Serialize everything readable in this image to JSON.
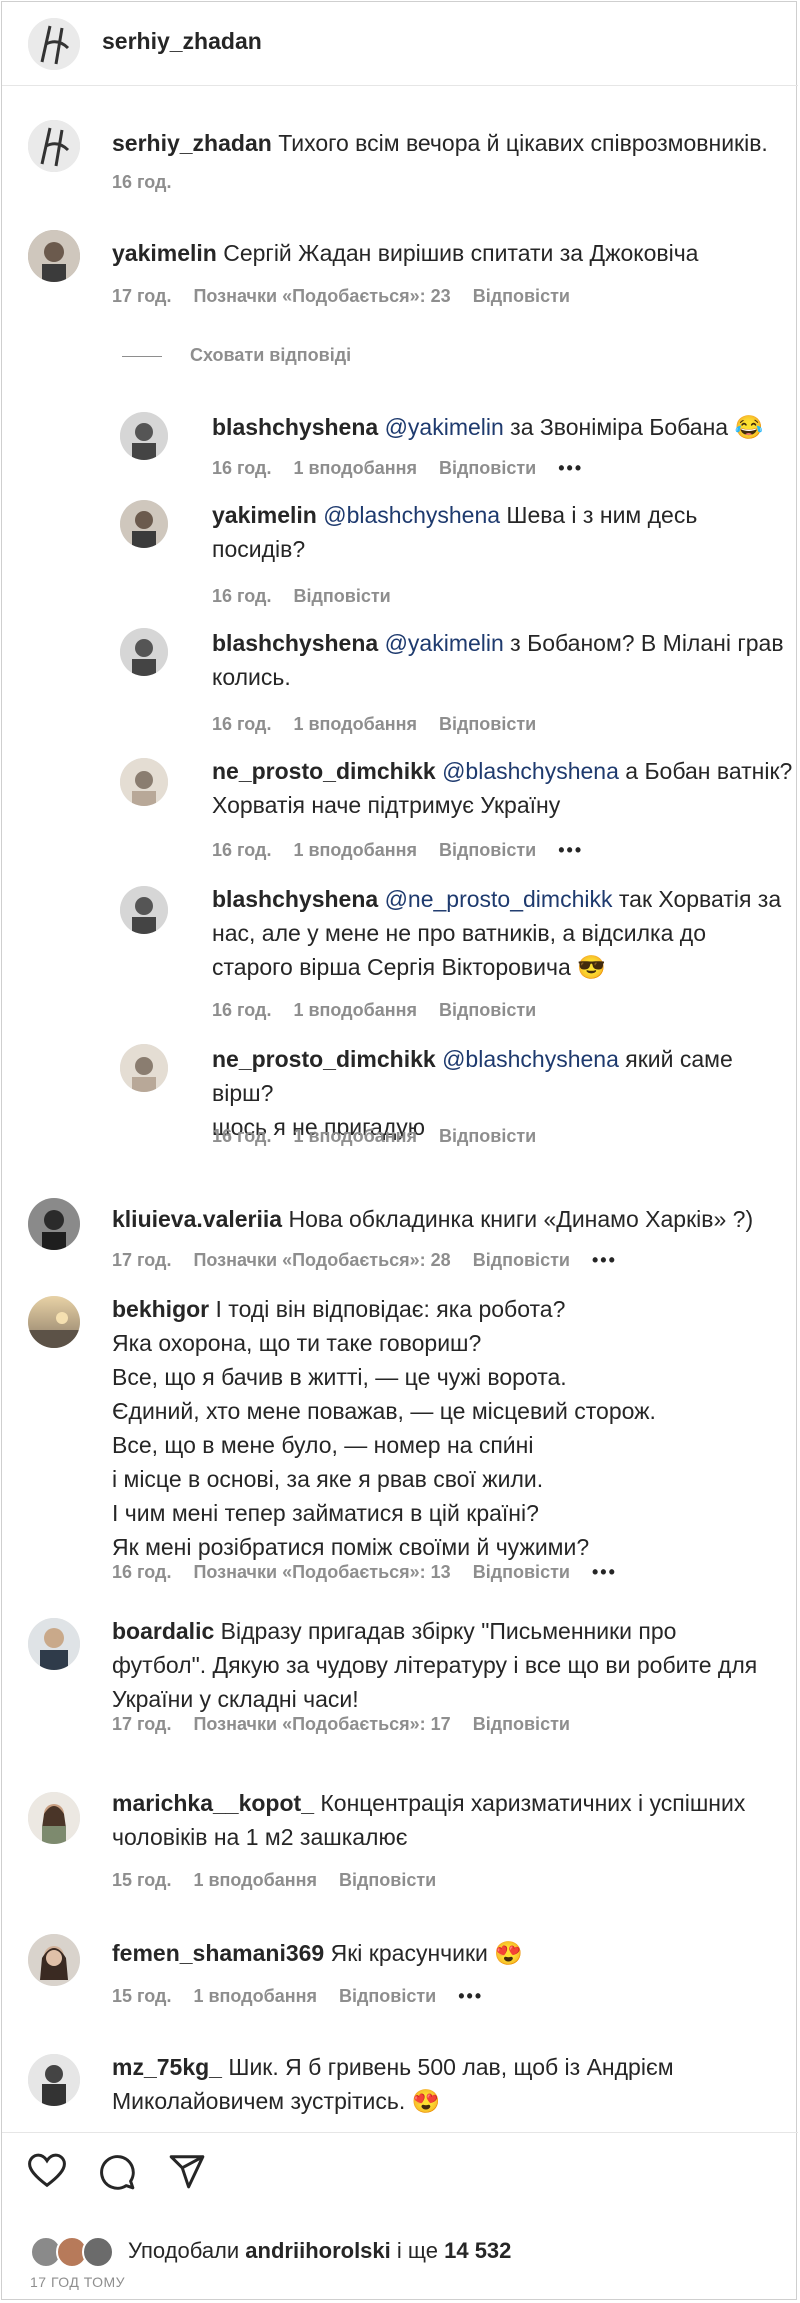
{
  "post": {
    "username": "serhiy_zhadan"
  },
  "caption": {
    "username": "serhiy_zhadan",
    "text": "Тихого всім вечора й цікавих співрозмовників.",
    "time": "16 год."
  },
  "comments": [
    {
      "username": "yakimelin",
      "text": "Сергій Жадан вирішив спитати за Джоковіча",
      "time": "17 год.",
      "likes": "Позначки «Подобається»: 23",
      "reply": "Відповісти"
    },
    {
      "username": "kliuieva.valeriia",
      "text": "Нова обкладинка книги «Динамо Харків» ?)",
      "time": "17 год.",
      "likes": "Позначки «Подобається»: 28",
      "reply": "Відповісти"
    },
    {
      "username": "bekhigor",
      "text": "І тоді він відповідає: яка робота?\nЯка охорона, що ти таке говориш?\nВсе, що я бачив в житті, — це чужі ворота.\nЄдиний, хто мене поважав, — це місцевий сторож.\nВсе, що в мене було, — номер на спи́ні\nі місце в основі, за яке я рвав свої жили.\nІ чим мені тепер займатися в цій країні?\nЯк мені розібратися поміж своїми й чужими?",
      "time": "16 год.",
      "likes": "Позначки «Подобається»: 13",
      "reply": "Відповісти"
    },
    {
      "username": "boardalic",
      "text": "Відразу пригадав збірку \"Письменники про\nфутбол\". Дякую за чудову літературу і все що ви робите для\nУкраїни у складні часи!",
      "time": "17 год.",
      "likes": "Позначки «Подобається»: 17",
      "reply": "Відповісти"
    },
    {
      "username": "marichka__kopot_",
      "text": "Концентрація харизматичних і успішних\nчоловіків на 1 м2 зашкалює",
      "time": "15 год.",
      "likes": "1 вподобання",
      "reply": "Відповісти"
    },
    {
      "username": "femen_shamani369",
      "text": "Які красунчики 😍",
      "time": "15 год.",
      "likes": "1 вподобання",
      "reply": "Відповісти"
    },
    {
      "username": "mz_75kg_",
      "text": "Шик. Я б гривень 500 лав, щоб із Андрієм\nМиколайовичем зустрітись. 😍"
    }
  ],
  "hide_replies": "Сховати відповіді",
  "replies": [
    {
      "username": "blashchyshena",
      "mention": "@yakimelin",
      "text": " за Звоніміра Бобана 😂",
      "time": "16 год.",
      "likes": "1 вподобання",
      "reply": "Відповісти"
    },
    {
      "username": "yakimelin",
      "mention": "@blashchyshena",
      "text": " Шева і з ним десь\nпосидів?",
      "time": "16 год.",
      "reply": "Відповісти"
    },
    {
      "username": "blashchyshena",
      "mention": "@yakimelin",
      "text": " з Бобаном? В Мілані грав\nколись.",
      "time": "16 год.",
      "likes": "1 вподобання",
      "reply": "Відповісти"
    },
    {
      "username": "ne_prosto_dimchikk",
      "mention": "@blashchyshena",
      "text": " а Бобан ватнік?\nХорватія наче підтримує Україну",
      "time": "16 год.",
      "likes": "1 вподобання",
      "reply": "Відповісти"
    },
    {
      "username": "blashchyshena",
      "mention": "@ne_prosto_dimchikk",
      "text": " так Хорватія за\nнас, але у мене не про ватників, а відсилка до\nстарого вірша Сергія Вікторовича 😎",
      "time": "16 год.",
      "likes": "1 вподобання",
      "reply": "Відповісти"
    },
    {
      "username": "ne_prosto_dimchikk",
      "mention": "@blashchyshena",
      "text": " який саме вірш?\nщось я не пригадую",
      "time": "16 год.",
      "likes": "1 вподобання",
      "reply": "Відповісти"
    }
  ],
  "more": "•••",
  "footer": {
    "likes_prefix": "Уподобали ",
    "likes_user": "andriihorolski",
    "likes_mid": " і ще ",
    "likes_count": "14 532",
    "time_ago": "17 ГОД ТОМУ"
  },
  "icons": [
    "heart-icon",
    "comment-icon",
    "share-icon",
    "more-icon"
  ]
}
